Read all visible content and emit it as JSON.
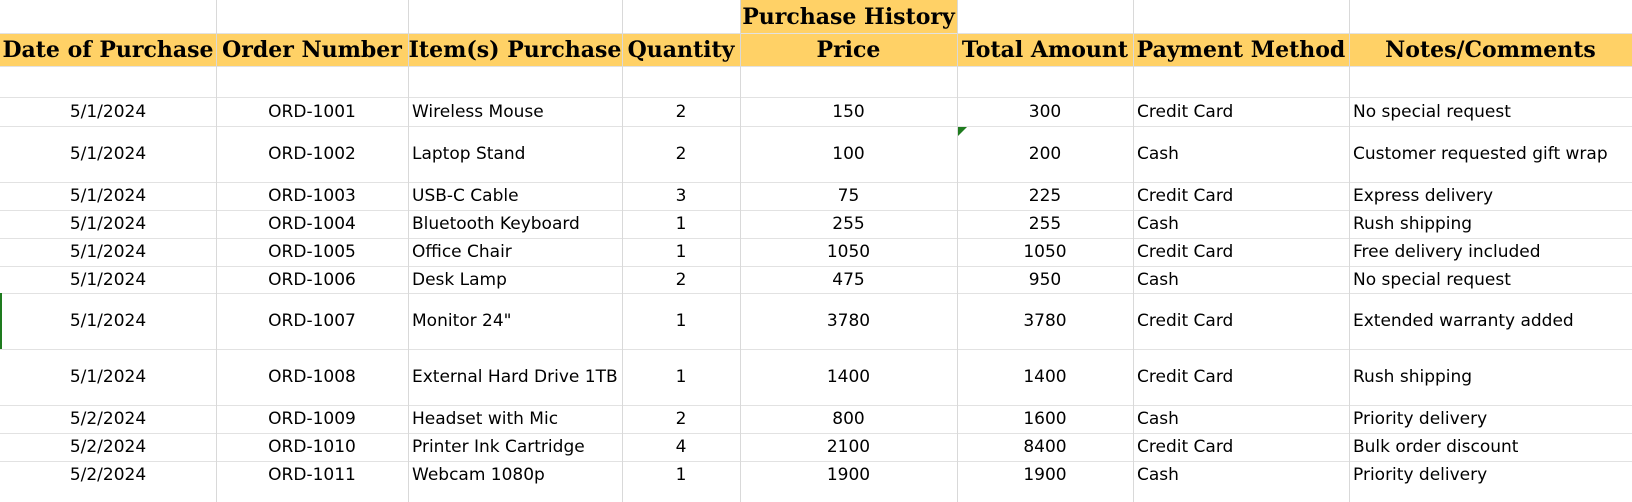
{
  "sheet": {
    "title": "Purchase History",
    "columns": [
      "Date of Purchase",
      "Order Number",
      "Item(s) Purchase",
      "Quantity",
      "Price",
      "Total Amount",
      "Payment Method",
      "Notes/Comments"
    ],
    "rows": [
      [
        "5/1/2024",
        "ORD-1001",
        "Wireless Mouse",
        "2",
        "150",
        "300",
        "Credit Card",
        "No special request"
      ],
      [
        "5/1/2024",
        "ORD-1002",
        "Laptop Stand",
        "2",
        "100",
        "200",
        "Cash",
        "Customer requested gift wrap"
      ],
      [
        "5/1/2024",
        "ORD-1003",
        "USB-C Cable",
        "3",
        "75",
        "225",
        "Credit Card",
        "Express delivery"
      ],
      [
        "5/1/2024",
        "ORD-1004",
        "Bluetooth Keyboard",
        "1",
        "255",
        "255",
        "Cash",
        "Rush shipping"
      ],
      [
        "5/1/2024",
        "ORD-1005",
        "Office Chair",
        "1",
        "1050",
        "1050",
        "Credit Card",
        "Free delivery included"
      ],
      [
        "5/1/2024",
        "ORD-1006",
        "Desk Lamp",
        "2",
        "475",
        "950",
        "Cash",
        "No special request"
      ],
      [
        "5/1/2024",
        "ORD-1007",
        "Monitor 24\"",
        "1",
        "3780",
        "3780",
        "Credit Card",
        "Extended warranty added"
      ],
      [
        "5/1/2024",
        "ORD-1008",
        "External Hard Drive 1TB",
        "1",
        "1400",
        "1400",
        "Credit Card",
        "Rush shipping"
      ],
      [
        "5/2/2024",
        "ORD-1009",
        "Headset with Mic",
        "2",
        "800",
        "1600",
        "Cash",
        "Priority delivery"
      ],
      [
        "5/2/2024",
        "ORD-1010",
        "Printer Ink Cartridge",
        "4",
        "2100",
        "8400",
        "Credit Card",
        "Bulk order discount"
      ],
      [
        "5/2/2024",
        "ORD-1011",
        "Webcam 1080p",
        "1",
        "1900",
        "1900",
        "Cash",
        "Priority delivery"
      ]
    ]
  },
  "colors": {
    "header_fill": "#ffd166",
    "gridline": "#d9d9d9",
    "error_indicator": "#1e7b1e"
  }
}
